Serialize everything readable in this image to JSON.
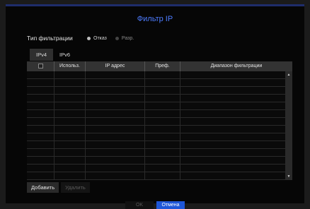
{
  "dialog": {
    "title": "Фильтр IP",
    "filter_label": "Тип фильтрации",
    "radio_options": [
      {
        "label": "Отказ",
        "selected": true
      },
      {
        "label": "Разр.",
        "selected": false
      }
    ]
  },
  "tabs": [
    {
      "label": "IPv4",
      "active": true
    },
    {
      "label": "IPv6",
      "active": false
    }
  ],
  "table": {
    "columns": [
      "",
      "Использ.",
      "IP адрес",
      "Преф.",
      "Диапазон фильтрации"
    ],
    "rows": 14
  },
  "buttons": {
    "add": "Добавить",
    "delete": "Удалить"
  },
  "footer": {
    "ok": "OK",
    "cancel": "Отмена"
  },
  "colors": {
    "accent": "#1e56d8",
    "title": "#4d7cff"
  }
}
